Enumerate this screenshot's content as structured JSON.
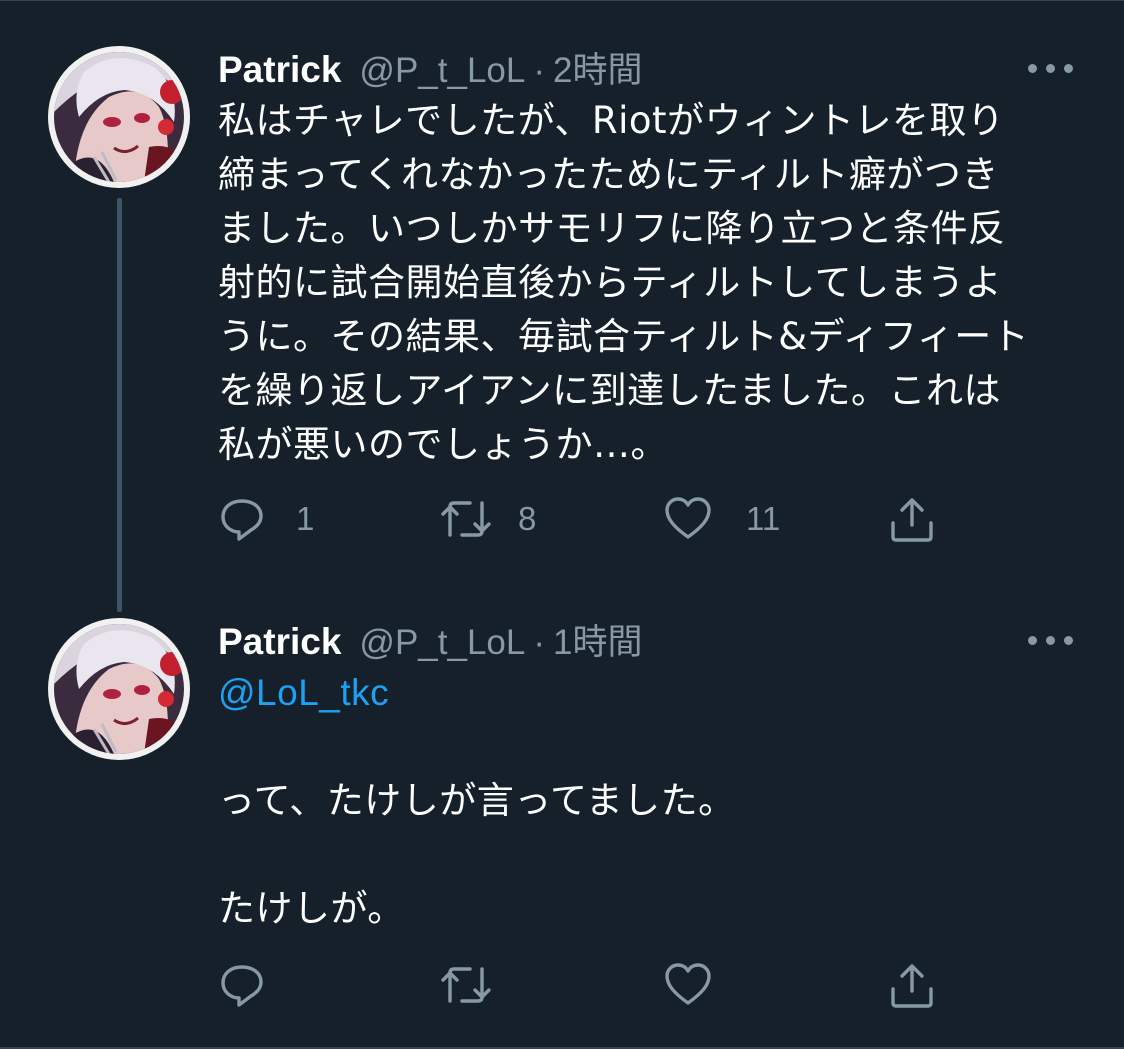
{
  "tweets": [
    {
      "author_name": "Patrick",
      "handle": "@P_t_LoL",
      "separator": "·",
      "time": "2時間",
      "text": "私はチャレでしたが、Riotがウィントレを取り\n締まってくれなかったためにティルト癖がつき\nました。いつしかサモリフに降り立つと条件反\n射的に試合開始直後からティルトしてしまうよ\nうに。その結果、毎試合ティルト&ディフィート\nを繰り返しアイアンに到達したました。これは\n私が悪いのでしょうか…。",
      "reply_count": "1",
      "retweet_count": "8",
      "like_count": "11"
    },
    {
      "author_name": "Patrick",
      "handle": "@P_t_LoL",
      "separator": "·",
      "time": "1時間",
      "mention": "@LoL_tkc",
      "text": "\n\nって、たけしが言ってました。\n\nたけしが。"
    }
  ],
  "icons": {
    "reply": "reply-icon",
    "retweet": "retweet-icon",
    "like": "like-icon",
    "share": "share-icon",
    "more": "more-icon"
  },
  "colors": {
    "background": "#15202b",
    "secondary_text": "#8899a6",
    "link": "#1da1f2"
  }
}
